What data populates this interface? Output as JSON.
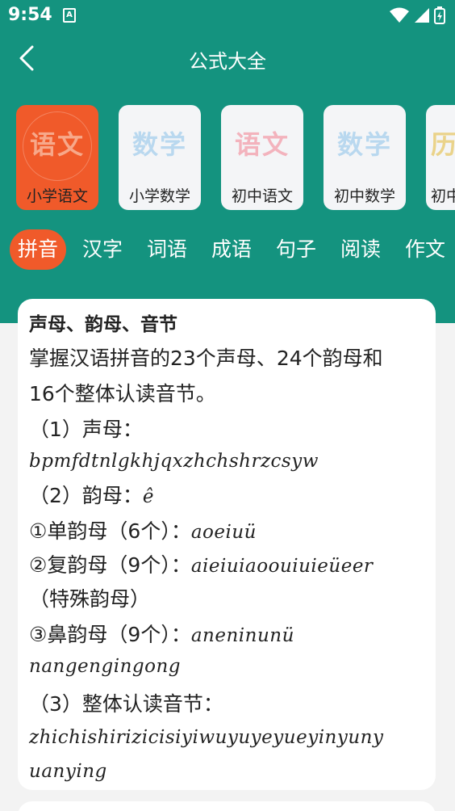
{
  "status": {
    "time": "9:54",
    "notif": "A"
  },
  "header": {
    "title": "公式大全"
  },
  "categories": [
    {
      "big": "语文",
      "label": "小学语文",
      "color": "#f7a88a"
    },
    {
      "big": "数学",
      "label": "小学数学",
      "color": "#b9d8ef"
    },
    {
      "big": "语文",
      "label": "初中语文",
      "color": "#f3b3bd"
    },
    {
      "big": "数学",
      "label": "初中数学",
      "color": "#b9d8ef"
    },
    {
      "big": "历",
      "label": "初中",
      "color": "#ead38a"
    }
  ],
  "tabs": [
    "拼音",
    "汉字",
    "词语",
    "成语",
    "句子",
    "阅读",
    "作文"
  ],
  "content": {
    "title": "声母、韵母、音节",
    "intro1": "掌握汉语拼音的23个声母、24个韵母和",
    "intro2": "16个整体认读音节。",
    "s1": "（1）声母：",
    "s1_val": "bpmfdtnlgkhjqxzhchshrzcsyw",
    "s2": "（2）韵母：",
    "s2_val": "ê",
    "a_label": "①单韵母（6个）：",
    "a_val": "aoeiuü",
    "b_label": "②复韵母（9个）：",
    "b_val": "aieiuiaoouiuieüeer",
    "b_note": "（特殊韵母）",
    "c_label": "③鼻韵母（9个）：",
    "c_val": "aneninunü",
    "c_val2": "nangengingong",
    "s3": "（3）整体认读音节：",
    "s3_val": "zhichishirizicisiyiwuyuyeyueyinyuny",
    "s3_val2": "uanying"
  }
}
